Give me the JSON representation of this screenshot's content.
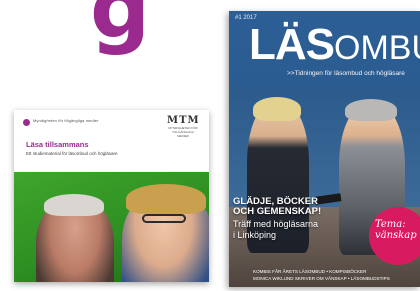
{
  "top_glyph": "g",
  "booklet": {
    "org_line": "Myndigheten för tillgängliga medier",
    "mtm_mark": "MTM",
    "mtm_sub": "MYNDIGHETEN FÖR TILLGÄNGLIGA MEDIER",
    "title": "Läsa tillsammans",
    "subtitle": "Ett studiematerial för läsombud och högläsare"
  },
  "magazine": {
    "issue": "#1 2017",
    "title_bold": "LÄS",
    "title_light": "OMBUDET",
    "tagline": ">>Tidningen för läsombud och högläsare",
    "headline_line1": "GLÄDJE, BÖCKER",
    "headline_line2": "OCH GEMENSKAP!",
    "subhead_line1": "Träff med högläsarna",
    "subhead_line2": "i Linköping",
    "badge_line1": "Tema:",
    "badge_line2": "vänskap",
    "footer_line1": "KOMBIS FÅR ÅRETS LÄSOMBUD • KOMPISBÖCKER",
    "footer_line2": "MONICA WIKLUND SKRIVER OM VÄNSKAP • LÄSOMBUDSTIPS"
  }
}
